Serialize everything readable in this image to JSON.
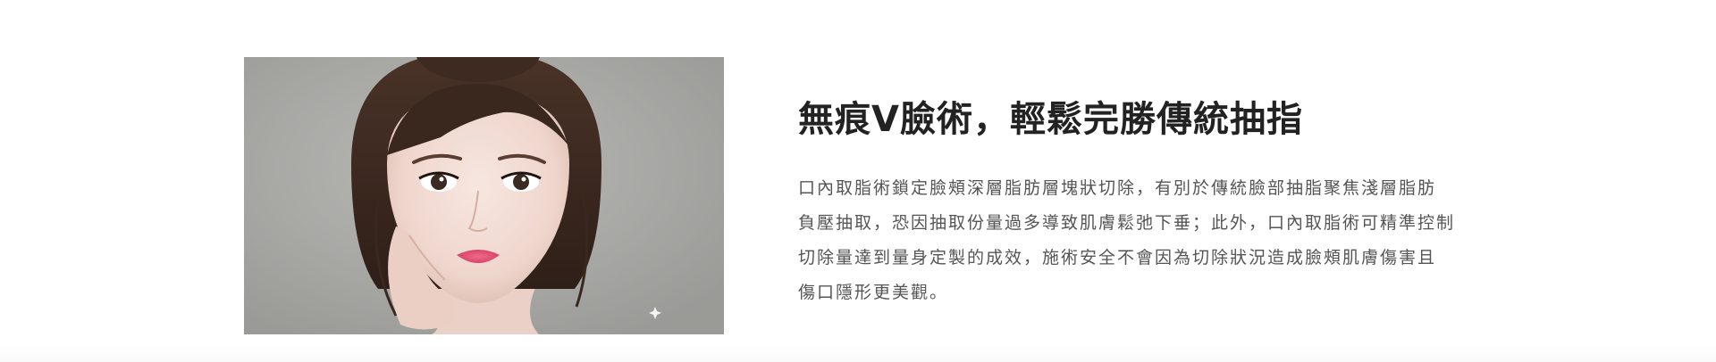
{
  "feature": {
    "image": {
      "icon": "face-portrait-image",
      "background_color": "#a8a8a5"
    },
    "headline": "無痕V臉術，輕鬆完勝傳統抽指",
    "body_lines": [
      "口內取脂術鎖定臉頰深層脂肪層塊狀切除，有別於傳統臉部抽脂聚焦淺層脂肪",
      "負壓抽取，恐因抽取份量過多導致肌膚鬆弛下垂；此外，口內取脂術可精準控制",
      "切除量達到量身定製的成效，施術安全不會因為切除狀況造成臉頰肌膚傷害且",
      "傷口隱形更美觀。"
    ],
    "colors": {
      "headline": "#222222",
      "body": "#555555"
    }
  }
}
